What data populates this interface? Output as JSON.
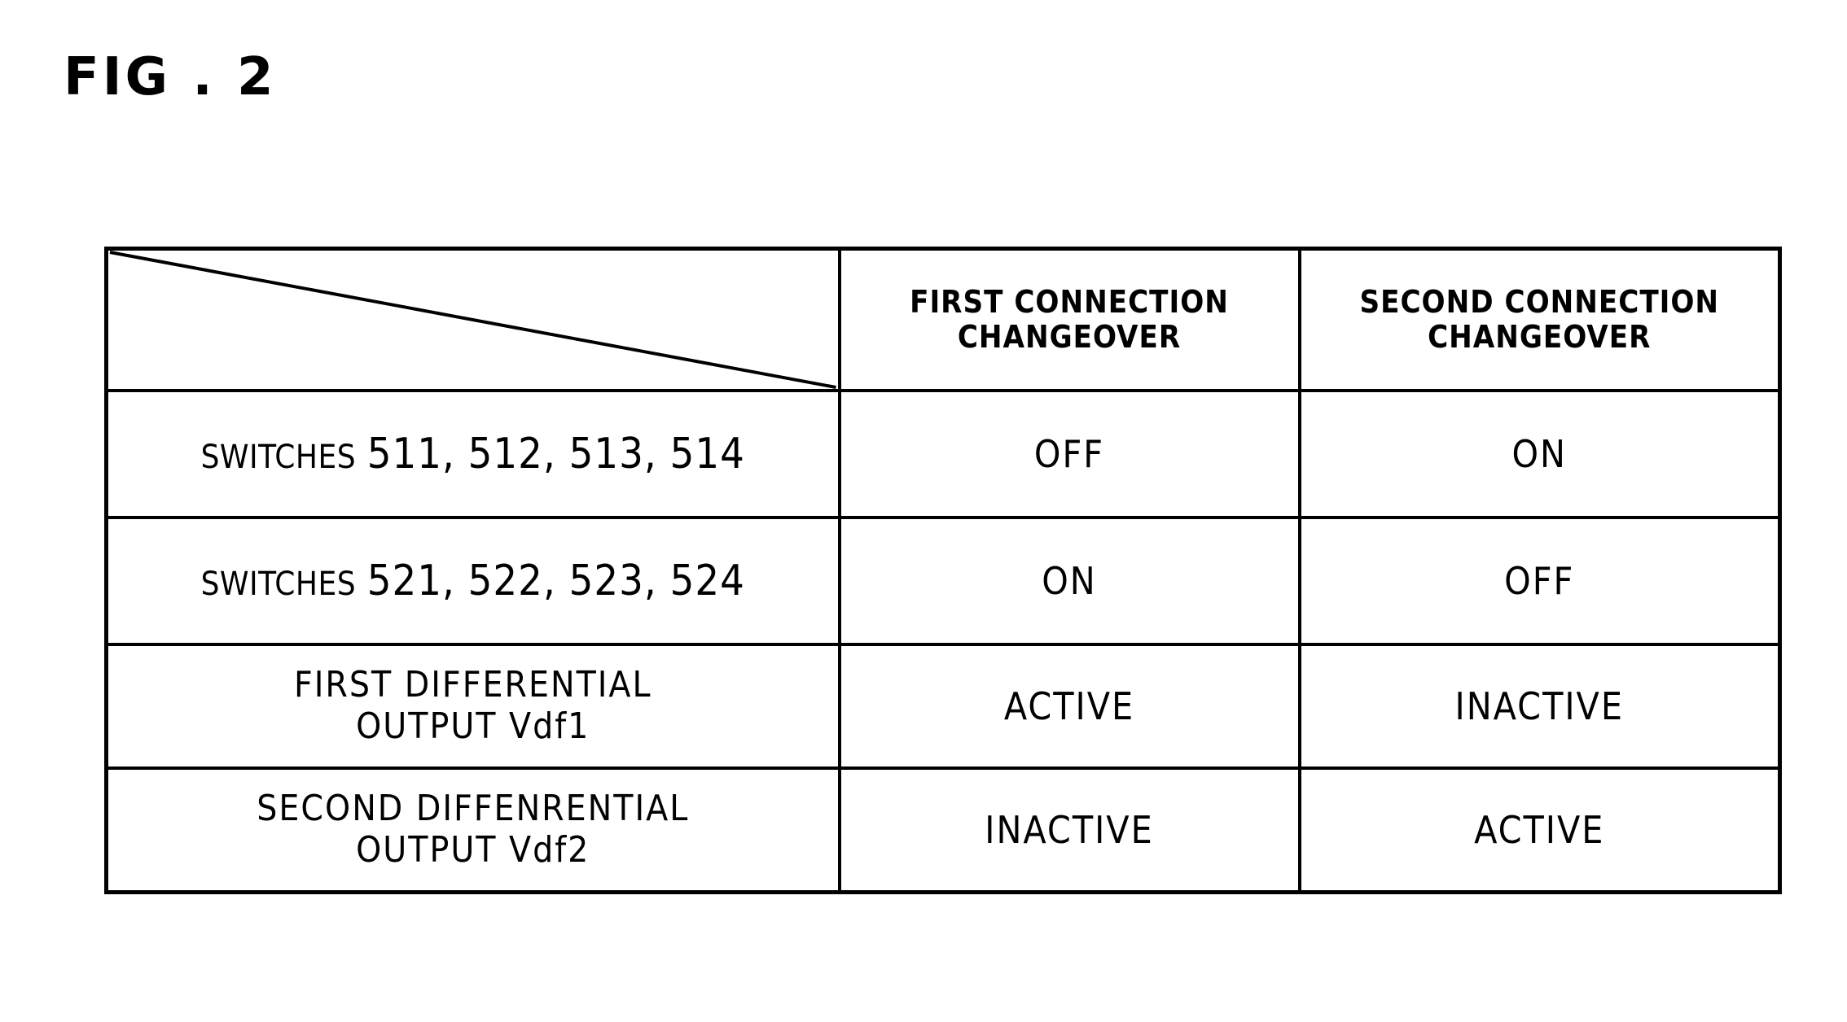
{
  "figure": {
    "label": "FIG . 2"
  },
  "table": {
    "corner_cell": "",
    "column_headers": [
      "FIRST CONNECTION",
      "CHANGEOVER",
      "SECOND CONNECTION",
      "CHANGEOVER"
    ],
    "header": {
      "col1_line1": "FIRST CONNECTION",
      "col1_line2": "CHANGEOVER",
      "col2_line1": "SECOND CONNECTION",
      "col2_line2": "CHANGEOVER"
    },
    "rows": [
      {
        "label_prefix": "SWITCHES",
        "label_numbers": "511, 512, 513, 514",
        "first_connection": "OFF",
        "second_connection": "ON"
      },
      {
        "label_prefix": "SWITCHES",
        "label_numbers": "521, 522, 523, 524",
        "first_connection": "ON",
        "second_connection": "OFF"
      },
      {
        "label_line1": "FIRST DIFFERENTIAL",
        "label_line2": "OUTPUT Vdf1",
        "first_connection": "ACTIVE",
        "second_connection": "INACTIVE"
      },
      {
        "label_line1": "SECOND DIFFENRENTIAL",
        "label_line2": "OUTPUT Vdf2",
        "first_connection": "INACTIVE",
        "second_connection": "ACTIVE"
      }
    ]
  }
}
